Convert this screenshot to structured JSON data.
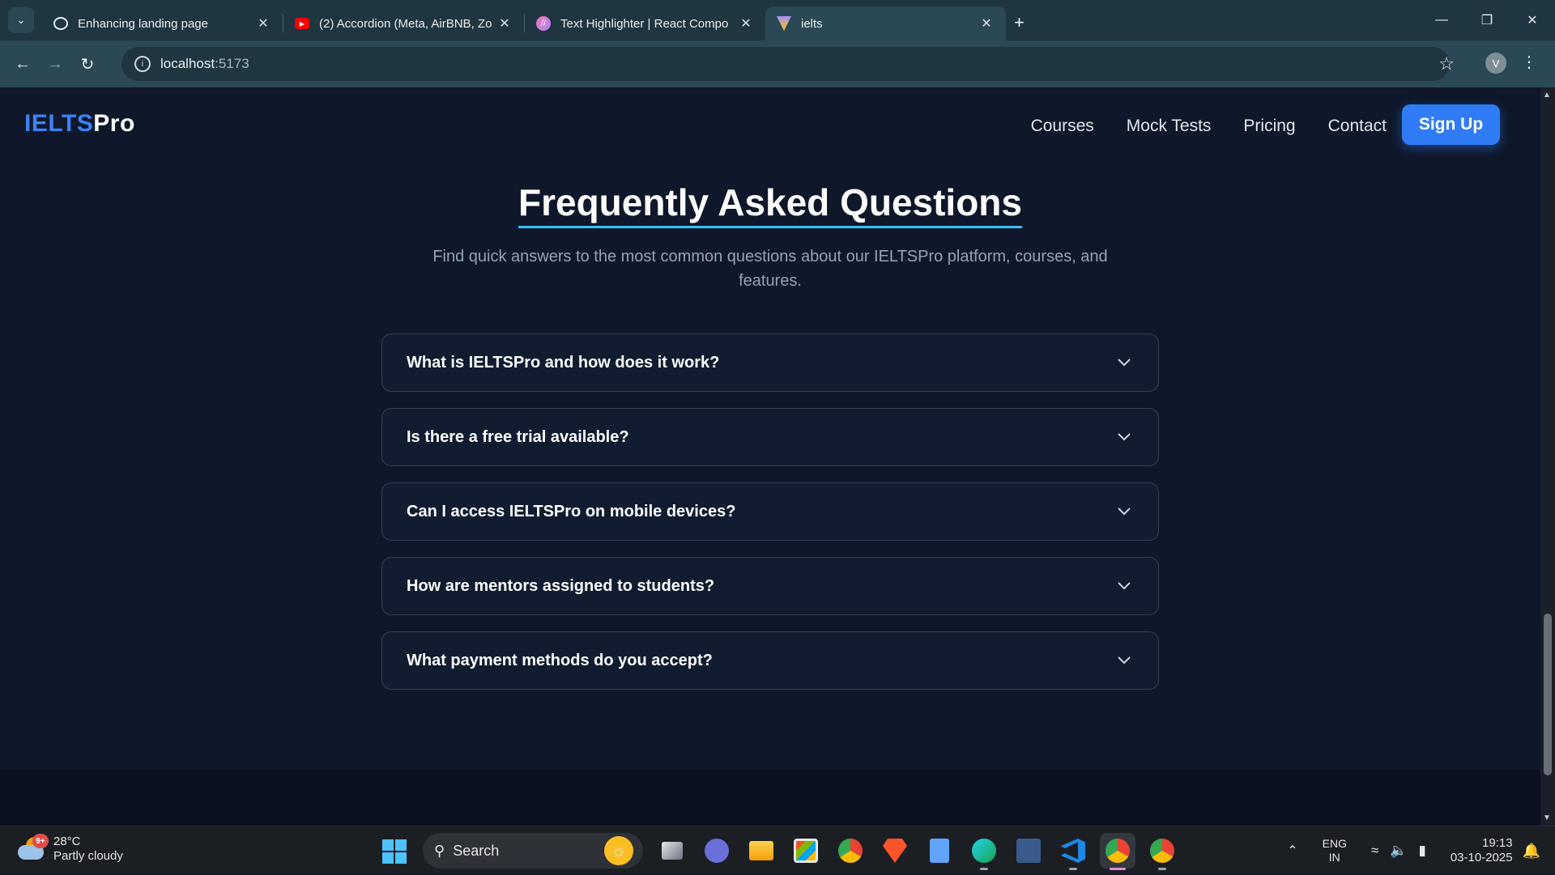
{
  "browser": {
    "tabs": [
      {
        "title": "Enhancing landing page",
        "favicon": "openai-icon",
        "active": false
      },
      {
        "title": "(2) Accordion (Meta, AirBNB, Zo",
        "favicon": "youtube-icon",
        "active": false
      },
      {
        "title": "Text Highlighter | React Compo",
        "favicon": "react-icon",
        "active": false
      },
      {
        "title": "ielts",
        "favicon": "vite-icon",
        "active": true
      }
    ],
    "url_host": "localhost",
    "url_port": ":5173",
    "profile_initial": "V"
  },
  "site": {
    "logo_part1": "IELTS",
    "logo_part2": "Pro",
    "nav": [
      "Courses",
      "Mock Tests",
      "Pricing",
      "Contact"
    ],
    "signup_label": "Sign Up"
  },
  "faq": {
    "title": "Frequently Asked Questions",
    "subtitle": "Find quick answers to the most common questions about our IELTSPro platform, courses, and features.",
    "items": [
      "What is IELTSPro and how does it work?",
      "Is there a free trial available?",
      "Can I access IELTSPro on mobile devices?",
      "How are mentors assigned to students?",
      "What payment methods do you accept?"
    ]
  },
  "taskbar": {
    "weather_temp": "28°C",
    "weather_desc": "Partly cloudy",
    "weather_badge": "9+",
    "search_label": "Search",
    "lang_top": "ENG",
    "lang_bottom": "IN",
    "time": "19:13",
    "date": "03-10-2025"
  },
  "colors": {
    "accent": "#2f7cf6",
    "logo_blue": "#3b82f6",
    "page_bg": "#0f172a",
    "card_bg": "#111c31",
    "underline": "#38bdf8"
  }
}
